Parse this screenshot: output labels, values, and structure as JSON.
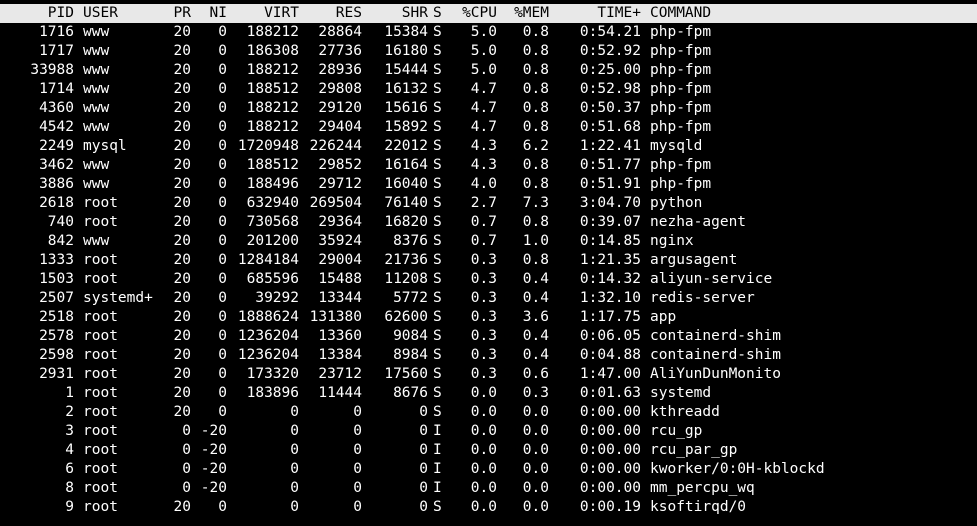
{
  "header": {
    "pid": "PID",
    "user": "USER",
    "pr": "PR",
    "ni": "NI",
    "virt": "VIRT",
    "res": "RES",
    "shr": "SHR",
    "s": "S",
    "cpu": "%CPU",
    "mem": "%MEM",
    "time": "TIME+",
    "command": "COMMAND"
  },
  "processes": [
    {
      "pid": "1716",
      "user": "www",
      "pr": "20",
      "ni": "0",
      "virt": "188212",
      "res": "28864",
      "shr": "15384",
      "s": "S",
      "cpu": "5.0",
      "mem": "0.8",
      "time": "0:54.21",
      "command": "php-fpm"
    },
    {
      "pid": "1717",
      "user": "www",
      "pr": "20",
      "ni": "0",
      "virt": "186308",
      "res": "27736",
      "shr": "16180",
      "s": "S",
      "cpu": "5.0",
      "mem": "0.8",
      "time": "0:52.92",
      "command": "php-fpm"
    },
    {
      "pid": "33988",
      "user": "www",
      "pr": "20",
      "ni": "0",
      "virt": "188212",
      "res": "28936",
      "shr": "15444",
      "s": "S",
      "cpu": "5.0",
      "mem": "0.8",
      "time": "0:25.00",
      "command": "php-fpm"
    },
    {
      "pid": "1714",
      "user": "www",
      "pr": "20",
      "ni": "0",
      "virt": "188512",
      "res": "29808",
      "shr": "16132",
      "s": "S",
      "cpu": "4.7",
      "mem": "0.8",
      "time": "0:52.98",
      "command": "php-fpm"
    },
    {
      "pid": "4360",
      "user": "www",
      "pr": "20",
      "ni": "0",
      "virt": "188212",
      "res": "29120",
      "shr": "15616",
      "s": "S",
      "cpu": "4.7",
      "mem": "0.8",
      "time": "0:50.37",
      "command": "php-fpm"
    },
    {
      "pid": "4542",
      "user": "www",
      "pr": "20",
      "ni": "0",
      "virt": "188212",
      "res": "29404",
      "shr": "15892",
      "s": "S",
      "cpu": "4.7",
      "mem": "0.8",
      "time": "0:51.68",
      "command": "php-fpm"
    },
    {
      "pid": "2249",
      "user": "mysql",
      "pr": "20",
      "ni": "0",
      "virt": "1720948",
      "res": "226244",
      "shr": "22012",
      "s": "S",
      "cpu": "4.3",
      "mem": "6.2",
      "time": "1:22.41",
      "command": "mysqld"
    },
    {
      "pid": "3462",
      "user": "www",
      "pr": "20",
      "ni": "0",
      "virt": "188512",
      "res": "29852",
      "shr": "16164",
      "s": "S",
      "cpu": "4.3",
      "mem": "0.8",
      "time": "0:51.77",
      "command": "php-fpm"
    },
    {
      "pid": "3886",
      "user": "www",
      "pr": "20",
      "ni": "0",
      "virt": "188496",
      "res": "29712",
      "shr": "16040",
      "s": "S",
      "cpu": "4.0",
      "mem": "0.8",
      "time": "0:51.91",
      "command": "php-fpm"
    },
    {
      "pid": "2618",
      "user": "root",
      "pr": "20",
      "ni": "0",
      "virt": "632940",
      "res": "269504",
      "shr": "76140",
      "s": "S",
      "cpu": "2.7",
      "mem": "7.3",
      "time": "3:04.70",
      "command": "python"
    },
    {
      "pid": "740",
      "user": "root",
      "pr": "20",
      "ni": "0",
      "virt": "730568",
      "res": "29364",
      "shr": "16820",
      "s": "S",
      "cpu": "0.7",
      "mem": "0.8",
      "time": "0:39.07",
      "command": "nezha-agent"
    },
    {
      "pid": "842",
      "user": "www",
      "pr": "20",
      "ni": "0",
      "virt": "201200",
      "res": "35924",
      "shr": "8376",
      "s": "S",
      "cpu": "0.7",
      "mem": "1.0",
      "time": "0:14.85",
      "command": "nginx"
    },
    {
      "pid": "1333",
      "user": "root",
      "pr": "20",
      "ni": "0",
      "virt": "1284184",
      "res": "29004",
      "shr": "21736",
      "s": "S",
      "cpu": "0.3",
      "mem": "0.8",
      "time": "1:21.35",
      "command": "argusagent"
    },
    {
      "pid": "1503",
      "user": "root",
      "pr": "20",
      "ni": "0",
      "virt": "685596",
      "res": "15488",
      "shr": "11208",
      "s": "S",
      "cpu": "0.3",
      "mem": "0.4",
      "time": "0:14.32",
      "command": "aliyun-service"
    },
    {
      "pid": "2507",
      "user": "systemd+",
      "pr": "20",
      "ni": "0",
      "virt": "39292",
      "res": "13344",
      "shr": "5772",
      "s": "S",
      "cpu": "0.3",
      "mem": "0.4",
      "time": "1:32.10",
      "command": "redis-server"
    },
    {
      "pid": "2518",
      "user": "root",
      "pr": "20",
      "ni": "0",
      "virt": "1888624",
      "res": "131380",
      "shr": "62600",
      "s": "S",
      "cpu": "0.3",
      "mem": "3.6",
      "time": "1:17.75",
      "command": "app"
    },
    {
      "pid": "2578",
      "user": "root",
      "pr": "20",
      "ni": "0",
      "virt": "1236204",
      "res": "13360",
      "shr": "9084",
      "s": "S",
      "cpu": "0.3",
      "mem": "0.4",
      "time": "0:06.05",
      "command": "containerd-shim"
    },
    {
      "pid": "2598",
      "user": "root",
      "pr": "20",
      "ni": "0",
      "virt": "1236204",
      "res": "13384",
      "shr": "8984",
      "s": "S",
      "cpu": "0.3",
      "mem": "0.4",
      "time": "0:04.88",
      "command": "containerd-shim"
    },
    {
      "pid": "2931",
      "user": "root",
      "pr": "20",
      "ni": "0",
      "virt": "173320",
      "res": "23712",
      "shr": "17560",
      "s": "S",
      "cpu": "0.3",
      "mem": "0.6",
      "time": "1:47.00",
      "command": "AliYunDunMonito"
    },
    {
      "pid": "1",
      "user": "root",
      "pr": "20",
      "ni": "0",
      "virt": "183896",
      "res": "11444",
      "shr": "8676",
      "s": "S",
      "cpu": "0.0",
      "mem": "0.3",
      "time": "0:01.63",
      "command": "systemd"
    },
    {
      "pid": "2",
      "user": "root",
      "pr": "20",
      "ni": "0",
      "virt": "0",
      "res": "0",
      "shr": "0",
      "s": "S",
      "cpu": "0.0",
      "mem": "0.0",
      "time": "0:00.00",
      "command": "kthreadd"
    },
    {
      "pid": "3",
      "user": "root",
      "pr": "0",
      "ni": "-20",
      "virt": "0",
      "res": "0",
      "shr": "0",
      "s": "I",
      "cpu": "0.0",
      "mem": "0.0",
      "time": "0:00.00",
      "command": "rcu_gp"
    },
    {
      "pid": "4",
      "user": "root",
      "pr": "0",
      "ni": "-20",
      "virt": "0",
      "res": "0",
      "shr": "0",
      "s": "I",
      "cpu": "0.0",
      "mem": "0.0",
      "time": "0:00.00",
      "command": "rcu_par_gp"
    },
    {
      "pid": "6",
      "user": "root",
      "pr": "0",
      "ni": "-20",
      "virt": "0",
      "res": "0",
      "shr": "0",
      "s": "I",
      "cpu": "0.0",
      "mem": "0.0",
      "time": "0:00.00",
      "command": "kworker/0:0H-kblockd"
    },
    {
      "pid": "8",
      "user": "root",
      "pr": "0",
      "ni": "-20",
      "virt": "0",
      "res": "0",
      "shr": "0",
      "s": "I",
      "cpu": "0.0",
      "mem": "0.0",
      "time": "0:00.00",
      "command": "mm_percpu_wq"
    },
    {
      "pid": "9",
      "user": "root",
      "pr": "20",
      "ni": "0",
      "virt": "0",
      "res": "0",
      "shr": "0",
      "s": "S",
      "cpu": "0.0",
      "mem": "0.0",
      "time": "0:00.19",
      "command": "ksoftirqd/0"
    }
  ]
}
